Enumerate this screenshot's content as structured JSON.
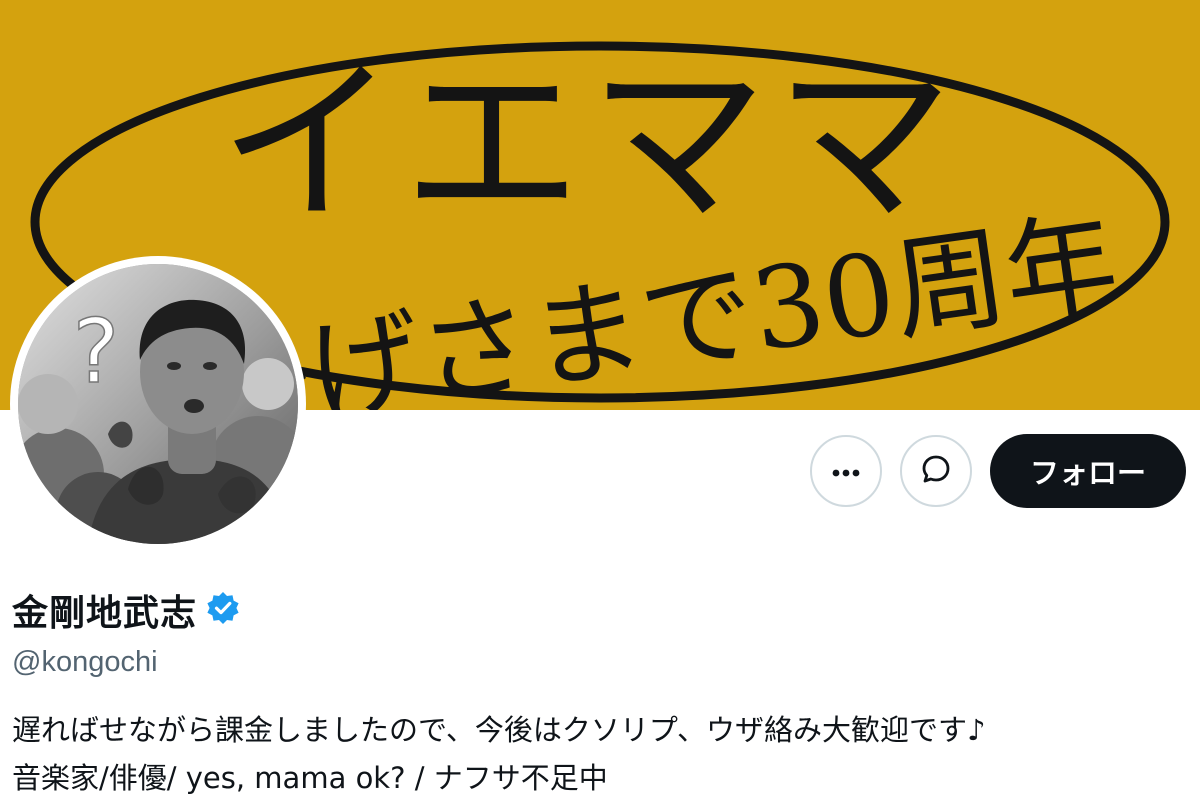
{
  "banner": {
    "line1": "イエママ",
    "line2": "おかげさまで30周年",
    "background_color": "#d4a20e",
    "ink_color": "#141414"
  },
  "avatar": {
    "question_mark": "?"
  },
  "actions": {
    "more_icon": "more-horizontal-icon",
    "message_icon": "message-bubble-icon",
    "follow_label": "フォロー"
  },
  "profile": {
    "display_name": "金剛地武志",
    "verified_badge_icon": "verified-badge-icon",
    "verified_color": "#1d9bf0",
    "handle": "@kongochi",
    "bio_line1": "遅ればせながら課金しましたので、今後はクソリプ、ウザ絡み大歓迎です♪",
    "bio_line2": "音楽家/俳優/ yes, mama ok? / ナフサ不足中"
  }
}
